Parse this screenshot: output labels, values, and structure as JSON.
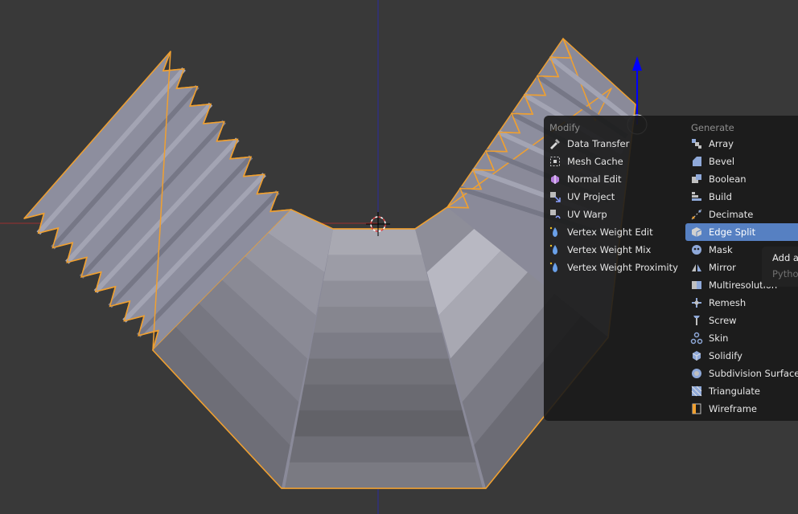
{
  "modifier_menu": {
    "modify": {
      "title": "Modify",
      "items": [
        {
          "label": "Data Transfer",
          "icon": "data-transfer-icon"
        },
        {
          "label": "Mesh Cache",
          "icon": "mesh-cache-icon"
        },
        {
          "label": "Normal Edit",
          "icon": "normal-edit-icon"
        },
        {
          "label": "UV Project",
          "icon": "uv-project-icon"
        },
        {
          "label": "UV Warp",
          "icon": "uv-warp-icon"
        },
        {
          "label": "Vertex Weight Edit",
          "icon": "vertex-weight-edit-icon"
        },
        {
          "label": "Vertex Weight Mix",
          "icon": "vertex-weight-mix-icon"
        },
        {
          "label": "Vertex Weight Proximity",
          "icon": "vertex-weight-proximity-icon"
        }
      ]
    },
    "generate": {
      "title": "Generate",
      "items": [
        {
          "label": "Array",
          "icon": "array-icon"
        },
        {
          "label": "Bevel",
          "icon": "bevel-icon"
        },
        {
          "label": "Boolean",
          "icon": "boolean-icon"
        },
        {
          "label": "Build",
          "icon": "build-icon"
        },
        {
          "label": "Decimate",
          "icon": "decimate-icon"
        },
        {
          "label": "Edge Split",
          "icon": "edge-split-icon",
          "highlighted": true
        },
        {
          "label": "Mask",
          "icon": "mask-icon"
        },
        {
          "label": "Mirror",
          "icon": "mirror-icon"
        },
        {
          "label": "Multiresolution",
          "icon": "multiresolution-icon"
        },
        {
          "label": "Remesh",
          "icon": "remesh-icon"
        },
        {
          "label": "Screw",
          "icon": "screw-icon"
        },
        {
          "label": "Skin",
          "icon": "skin-icon"
        },
        {
          "label": "Solidify",
          "icon": "solidify-icon"
        },
        {
          "label": "Subdivision Surface",
          "icon": "subdivision-surface-icon"
        },
        {
          "label": "Triangulate",
          "icon": "triangulate-icon"
        },
        {
          "label": "Wireframe",
          "icon": "wireframe-icon"
        }
      ]
    }
  },
  "tooltip": {
    "title": "Add a",
    "python": "Pytho"
  },
  "colors": {
    "viewport_bg": "#393939",
    "menu_bg": "#191919",
    "highlight": "#5680c2",
    "selection_outline": "#f0a030",
    "mesh_face": "#8a8a9a",
    "y_axis": "#2a2a9e",
    "x_axis": "#9a3030",
    "manipulator": "#0000ff"
  }
}
